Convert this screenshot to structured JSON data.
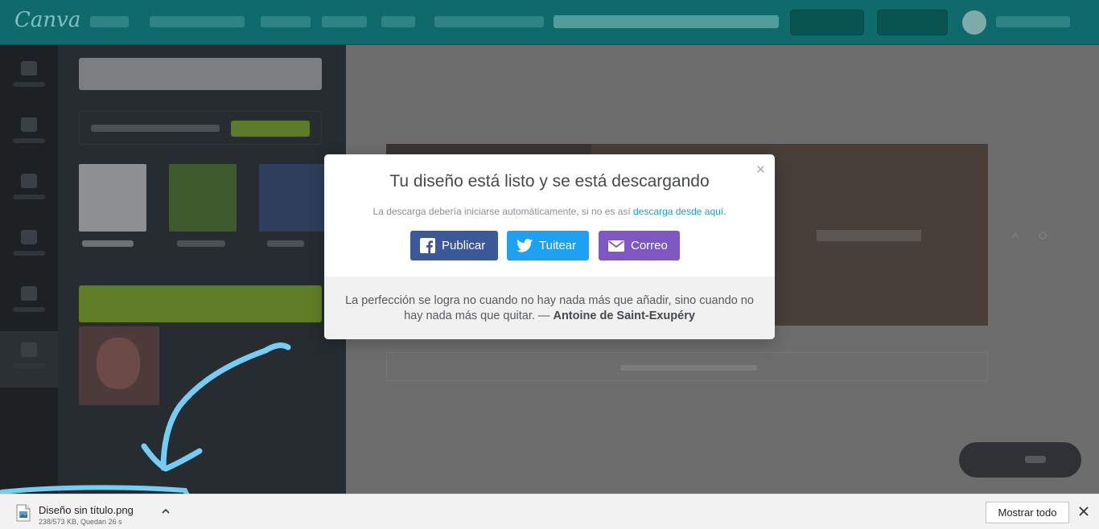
{
  "modal": {
    "title": "Tu diseño está listo y se está descargando",
    "subtitle_text": "La descarga debería iniciarse automáticamente, si no es así ",
    "subtitle_link": "descarga desde aquí.",
    "close_glyph": "×",
    "share_buttons": [
      {
        "label": "Publicar",
        "icon": "facebook-icon",
        "color": "#3b5998"
      },
      {
        "label": "Tuitear",
        "icon": "twitter-icon",
        "color": "#1da1f2"
      },
      {
        "label": "Correo",
        "icon": "email-icon",
        "color": "#7e57c2"
      }
    ],
    "quote_text": "La perfección se logra no cuando no hay nada más que añadir, sino cuando no hay nada más que quitar. — ",
    "quote_author": "Antoine de Saint-Exupéry"
  },
  "download_bar": {
    "file_name": "Diseño sin título.png",
    "file_status": "238/573 KB, Quedan 26 s",
    "show_all_label": "Mostrar todo"
  },
  "colors": {
    "topbar": "#0f6b6b",
    "accent_link": "#18a5b5",
    "annotation": "#74cdf5"
  }
}
